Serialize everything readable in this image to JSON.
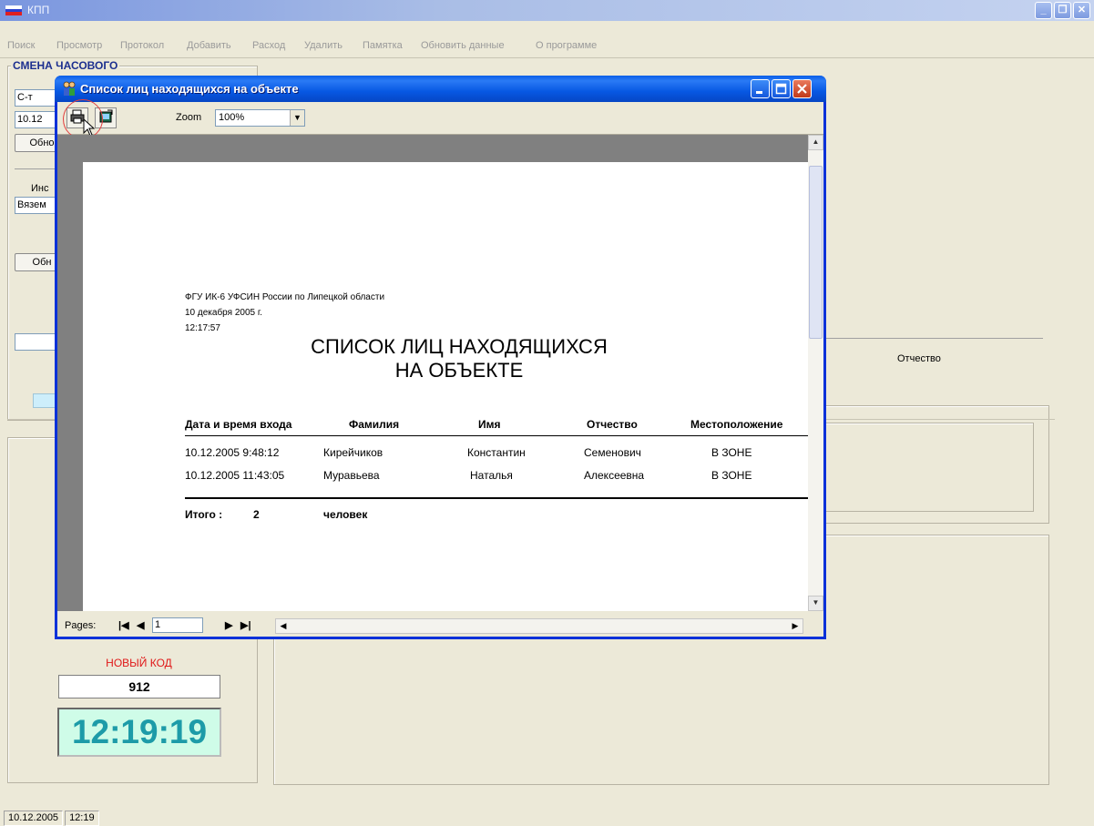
{
  "main_window": {
    "title": "КПП",
    "buttons": {
      "minimize": "_",
      "restore": "❐",
      "close": "✕"
    }
  },
  "menu": [
    "Поиск",
    "Просмотр",
    "Протокол",
    "Добавить",
    "Расход",
    "Удалить",
    "Памятка",
    "Обновить данные",
    "О программе"
  ],
  "left_panel": {
    "group_title": "СМЕНА ЧАСОВОГО",
    "field1": "С-т",
    "field2": "10.12",
    "button1": "Обно",
    "inspector_label": "Инс",
    "inspector_value": "Вязем",
    "button2": "Обн",
    "new_code_label": "НОВЫЙ КОД",
    "new_code_value": "912",
    "clock": "12:19:19"
  },
  "background_right": {
    "column_header": "Отчество"
  },
  "status_bar": {
    "date": "10.12.2005",
    "time": "12:19"
  },
  "dialog": {
    "title": "Список лиц находящихся на объекте",
    "zoom_label": "Zoom",
    "zoom_value": "100%",
    "pages_label": "Pages:",
    "page_number": "1",
    "report": {
      "org": "ФГУ ИК-6 УФСИН России по Липецкой области",
      "date": "10 декабря 2005 г.",
      "time": "12:17:57",
      "title_line1": "СПИСОК ЛИЦ НАХОДЯЩИХСЯ",
      "title_line2": "НА ОБЪЕКТЕ",
      "columns": [
        "Дата и время входа",
        "Фамилия",
        "Имя",
        "Отчество",
        "Местоположение"
      ],
      "rows": [
        [
          "10.12.2005 9:48:12",
          "Кирейчиков",
          "Константин",
          "Семенович",
          "В ЗОНЕ"
        ],
        [
          "10.12.2005 11:43:05",
          "Муравьева",
          "Наталья",
          "Алексеевна",
          "В ЗОНЕ"
        ]
      ],
      "total_label": "Итого :",
      "total_value": "2",
      "total_unit": "человек"
    }
  },
  "colors": {
    "xp_blue": "#0831d9",
    "new_code_red": "#e01818",
    "clock_text": "#1d9ba8",
    "clock_bg": "#cffce8",
    "group_title": "#1c2f8f"
  }
}
